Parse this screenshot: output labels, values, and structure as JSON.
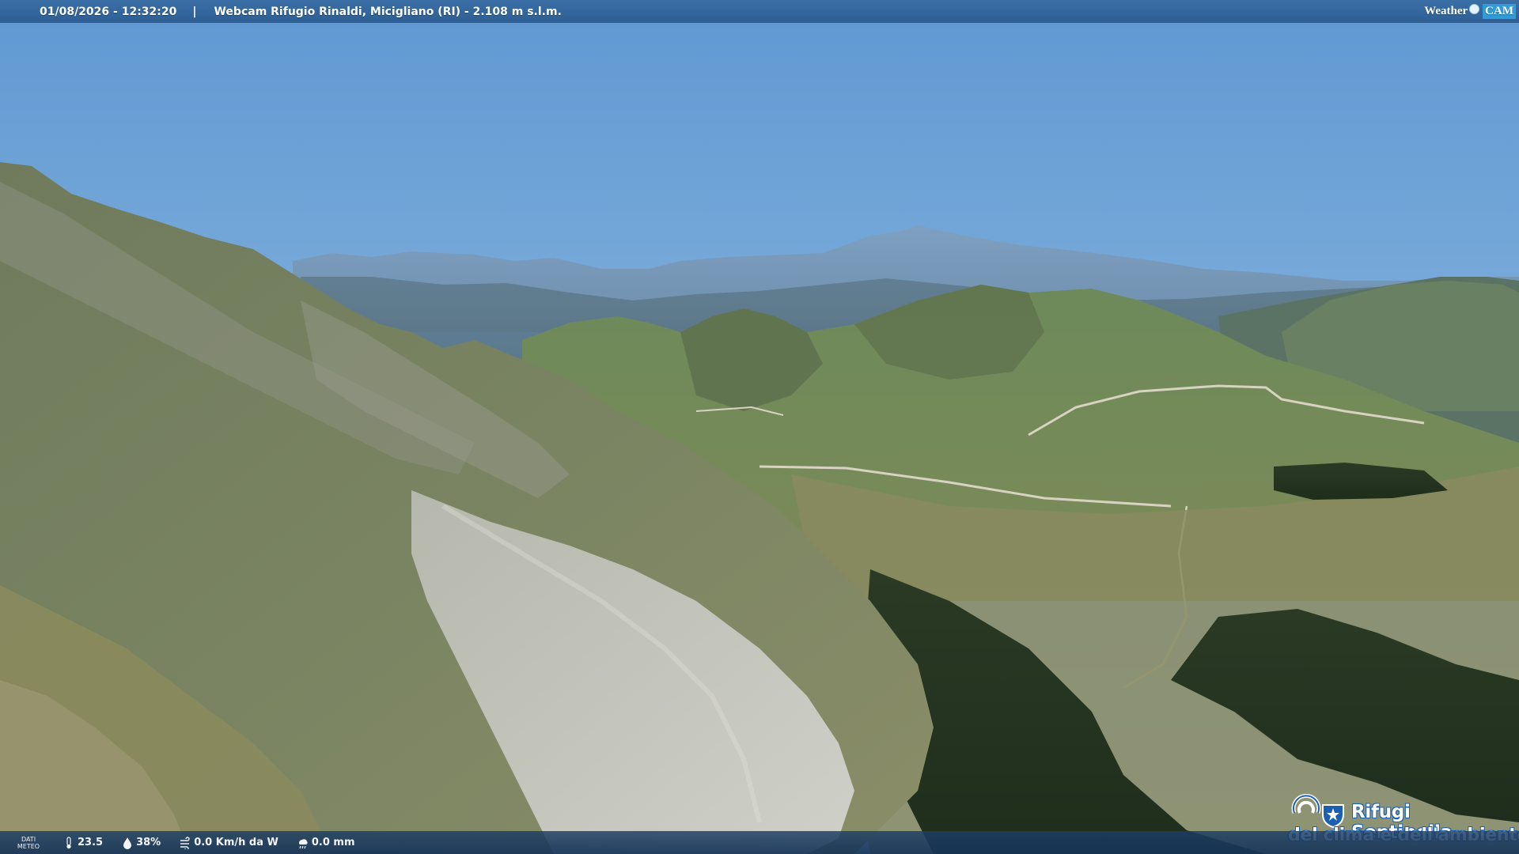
{
  "topbar": {
    "timestamp": "01/08/2026 - 12:32:20",
    "separator": "|",
    "title": "Webcam Rifugio Rinaldi, Micigliano (RI) - 2.108 m s.l.m.",
    "brand_left": "Weather",
    "brand_right": "CAM"
  },
  "bottombar": {
    "dati_label_1": "DATI",
    "dati_label_2": "METEO",
    "temperature": "23.5",
    "humidity": "38%",
    "wind": "0.0 Km/h da W",
    "rain": "0.0 mm"
  },
  "logo": {
    "line1": "Rifugi Sentinella",
    "line2": "del clima e dell'ambiente"
  },
  "icons": {
    "temperature": "thermometer-icon",
    "humidity": "humidity-icon",
    "wind": "wind-icon",
    "rain": "rain-icon"
  }
}
